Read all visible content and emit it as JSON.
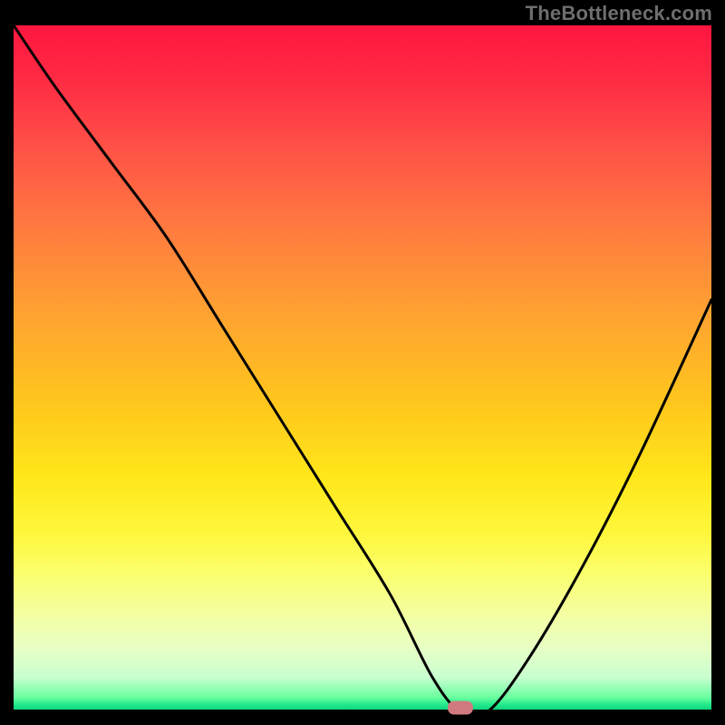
{
  "watermark": "TheBottleneck.com",
  "chart_data": {
    "type": "line",
    "title": "",
    "xlabel": "",
    "ylabel": "",
    "xlim": [
      0,
      100
    ],
    "ylim": [
      0,
      100
    ],
    "grid": false,
    "legend": false,
    "annotations": [
      {
        "name": "min-marker",
        "x": 64,
        "y": 0
      }
    ],
    "series": [
      {
        "name": "bottleneck-curve",
        "x": [
          0,
          6,
          14,
          22,
          30,
          38,
          46,
          54,
          60,
          64,
          68,
          74,
          82,
          90,
          100
        ],
        "values": [
          100,
          91,
          80,
          69,
          56,
          43,
          30,
          17,
          5,
          0,
          0,
          8,
          22,
          38,
          60
        ]
      }
    ],
    "background_gradient": {
      "top": "#ff163f",
      "middle": "#ffe71a",
      "bottom": "#0cce7c"
    }
  },
  "marker": {
    "color": "#d07a7f"
  }
}
